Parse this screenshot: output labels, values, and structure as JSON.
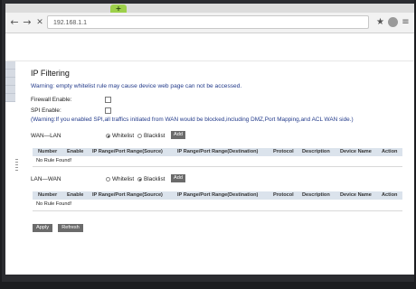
{
  "browser": {
    "new_tab_label": "+",
    "url": "192.168.1.1",
    "back_glyph": "←",
    "forward_glyph": "→",
    "close_glyph": "✕",
    "star_glyph": "★",
    "menu_glyph": "≡"
  },
  "page": {
    "title": "IP Filtering",
    "warning": "Warning: empty whitelist rule may cause device web page can not be accessed.",
    "firewall_label": "Firewall Enable:",
    "spi_label": "SPI Enable:",
    "spi_note": "(Warning:If you enabled SPI,all traffics initiated from WAN would be blocked,including DMZ,Port Mapping,and ACL WAN side.)"
  },
  "wan_lan": {
    "label": "WAN—LAN",
    "whitelist_label": "Whitelist",
    "blacklist_label": "Blacklist",
    "selected": "Whitelist",
    "add_label": "Add",
    "empty_text": "No Rule Found!"
  },
  "lan_wan": {
    "label": "LAN—WAN",
    "whitelist_label": "Whitelist",
    "blacklist_label": "Blacklist",
    "selected": "Blacklist",
    "add_label": "Add",
    "empty_text": "No Rule Found!"
  },
  "table_headers": [
    "Number",
    "Enable",
    "IP Range/Port Range(Source)",
    "IP Range/Port Range(Destination)",
    "Protocol",
    "Description",
    "Device Name",
    "Action"
  ],
  "footer": {
    "apply_label": "Apply",
    "refresh_label": "Refresh"
  },
  "colors": {
    "warning_text": "#223a8a",
    "table_header_bg": "#dbe3ec",
    "button_bg": "#6b6b6b",
    "tab_accent": "#9dd04a"
  }
}
